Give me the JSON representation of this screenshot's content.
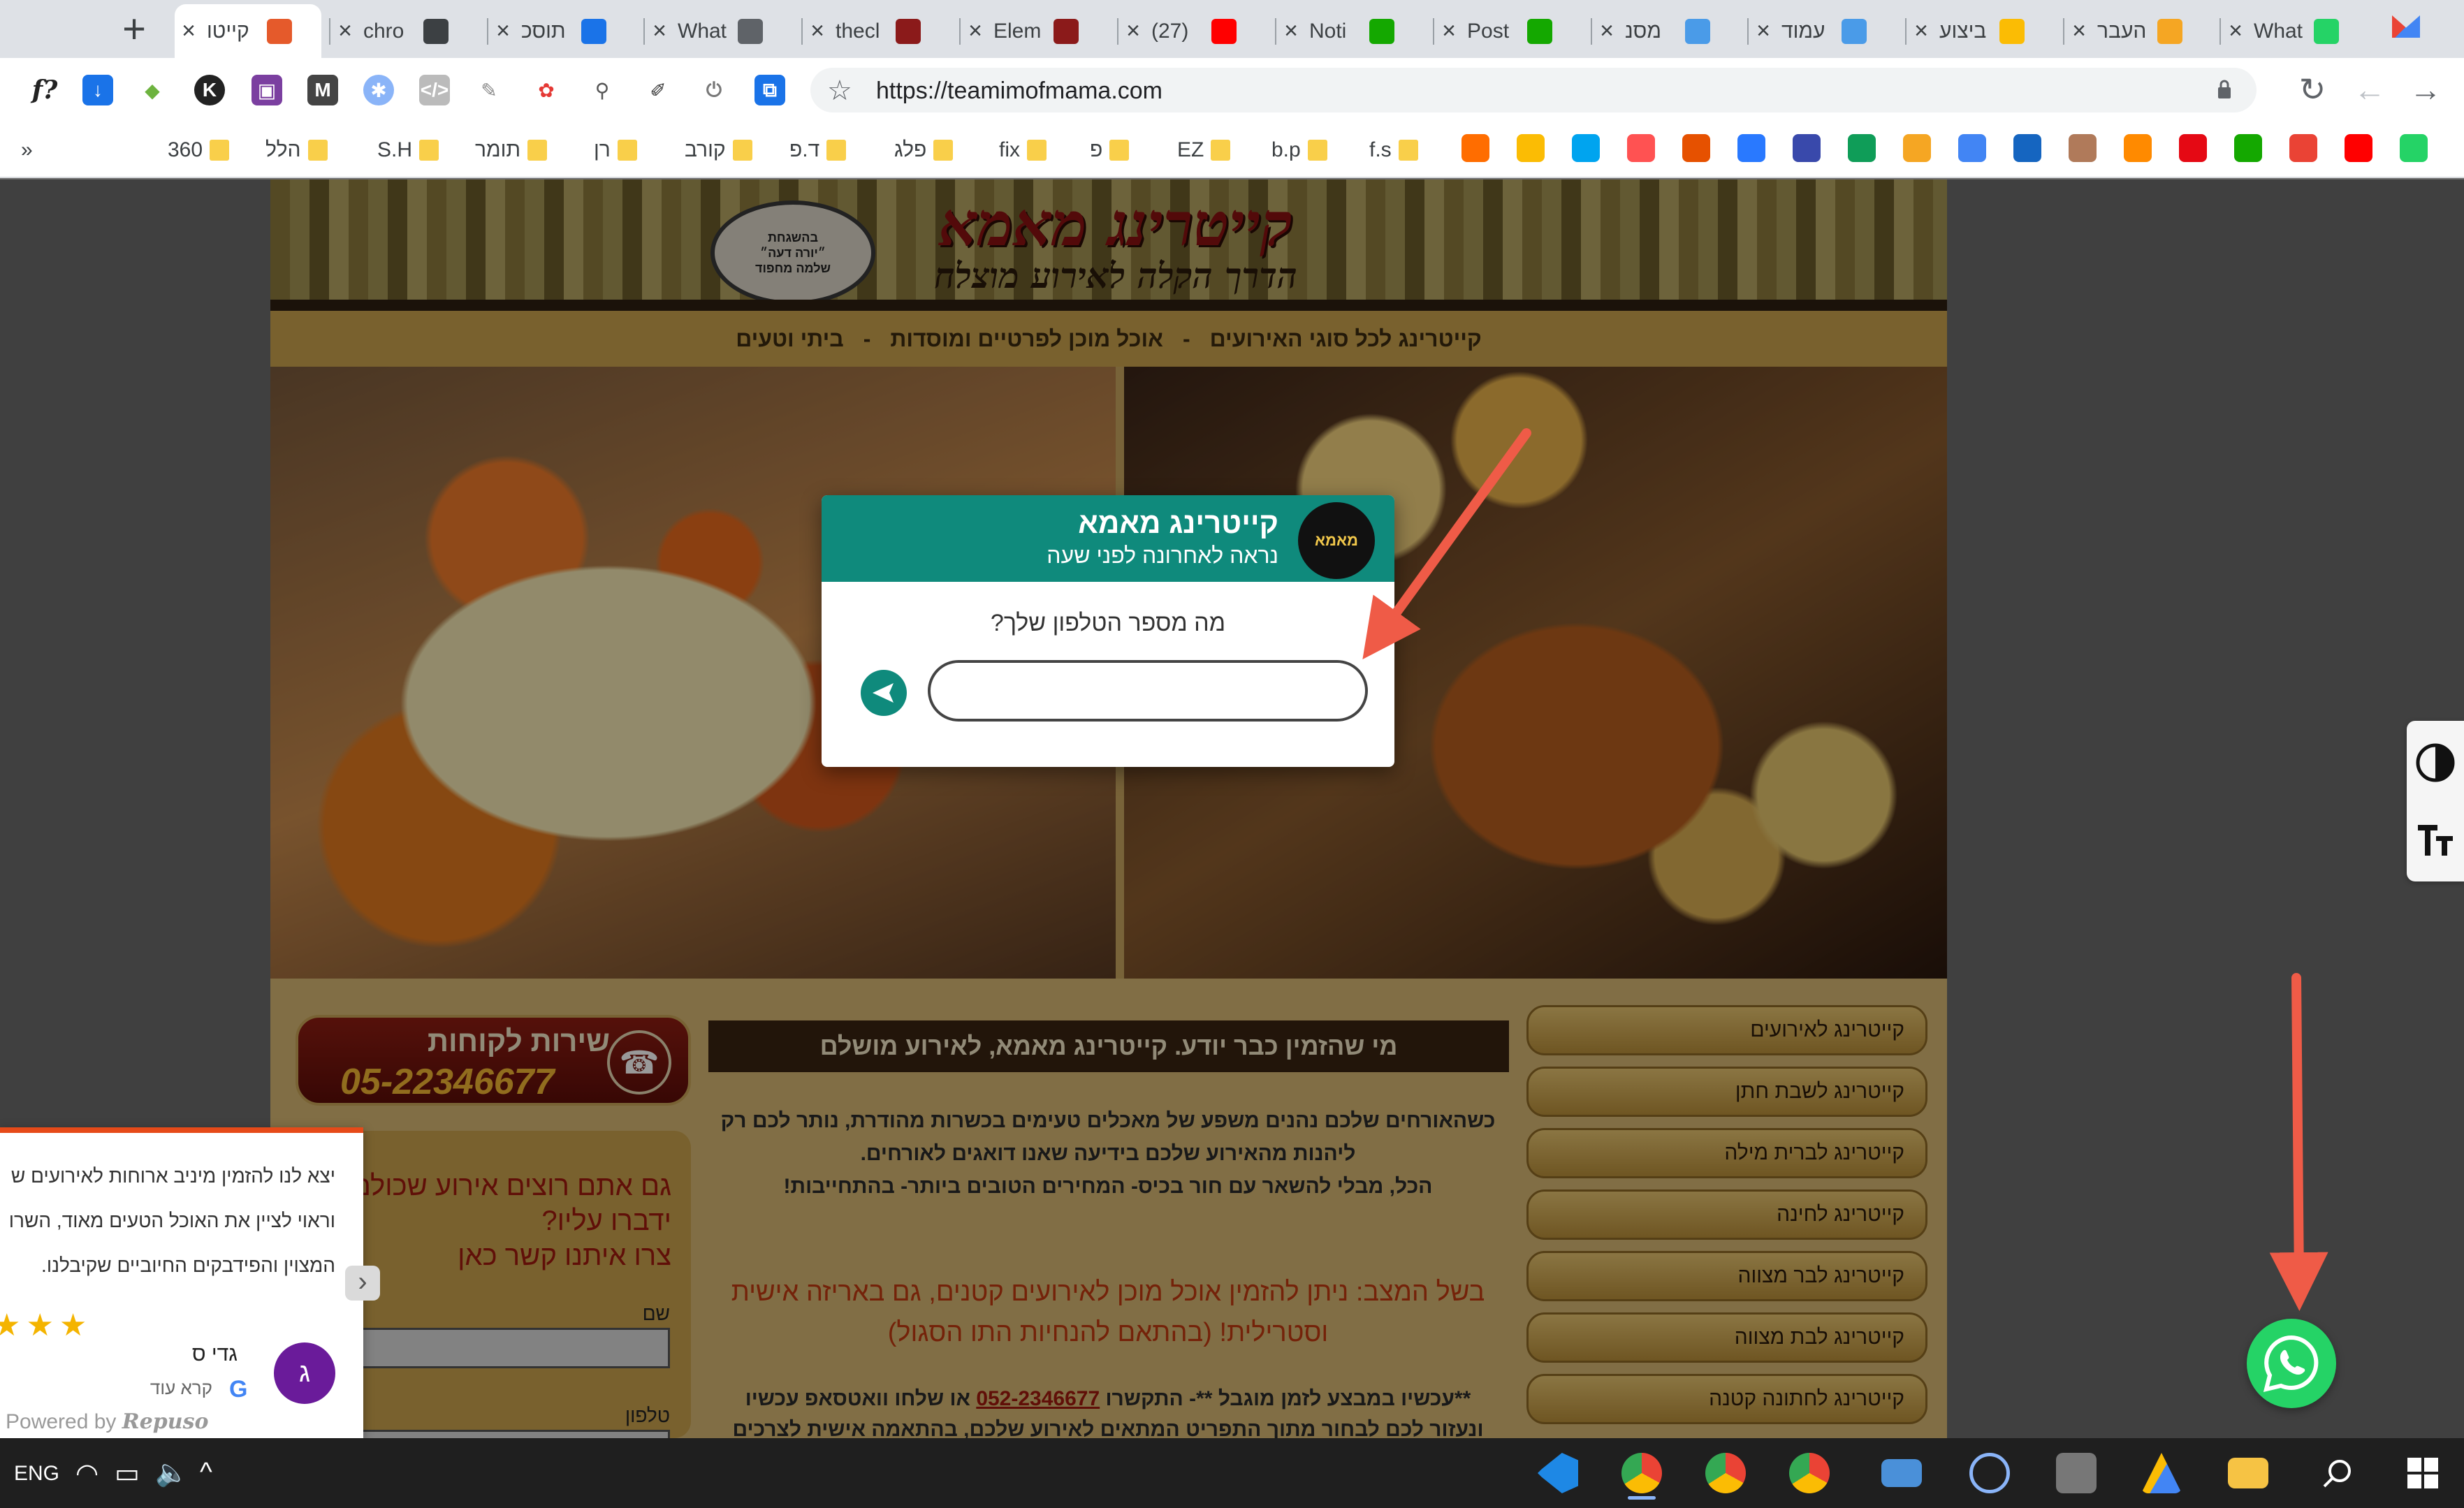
{
  "browser": {
    "tabs": [
      {
        "title": "קייטו",
        "favicon_color": "#e55a2b",
        "active": true
      },
      {
        "title": "chro",
        "favicon_color": "#3c4043",
        "active": false
      },
      {
        "title": "תוסכ",
        "favicon_color": "#1a73e8",
        "active": false
      },
      {
        "title": "What",
        "favicon_color": "#5f6368",
        "active": false
      },
      {
        "title": "thecl",
        "favicon_color": "#8b1a1a",
        "active": false
      },
      {
        "title": "Elem",
        "favicon_color": "#8b1a1a",
        "active": false
      },
      {
        "title": "(27)",
        "favicon_color": "#ff0000",
        "active": false
      },
      {
        "title": "Noti",
        "favicon_color": "#14a800",
        "active": false
      },
      {
        "title": "Post",
        "favicon_color": "#14a800",
        "active": false
      },
      {
        "title": "מסנ",
        "favicon_color": "#4a9be8",
        "active": false
      },
      {
        "title": "עמוד",
        "favicon_color": "#4a9be8",
        "active": false
      },
      {
        "title": "ביצוע",
        "favicon_color": "#fbbc04",
        "active": false
      },
      {
        "title": "העבר",
        "favicon_color": "#f5a623",
        "active": false
      },
      {
        "title": "What",
        "favicon_color": "#25d366",
        "active": false
      }
    ],
    "new_tab_label": "+",
    "url": "https://teamimofmama.com",
    "bookmarks": [
      "360",
      "הלל",
      "S.H",
      "תומר",
      "רן",
      "קורב",
      "ד.פ",
      "פלג",
      "fix",
      "פ",
      "EZ",
      "b.p",
      "f.s"
    ],
    "bookmarks_overflow": "»"
  },
  "site": {
    "name": "קייטרינג מאמא",
    "tagline": "הדרך הקלה לאירוע מוצלח",
    "seal_lines": [
      "בהשגחת",
      "״יורה דעה״",
      "שלמה מחפוד"
    ],
    "nav": [
      "קייטרינג לכל סוגי האירועים",
      "אוכל מוכן לפרטיים ומוסדות",
      "ביתי וטעים"
    ],
    "nav_separator": "-",
    "service_title": "שירות לקוחות",
    "service_phone": "05-22346677",
    "headline": "מי שהזמין כבר יודע. קייטרינג מאמא, לאירוע מושלם",
    "intro_lines": [
      "כשהאורחים שלכם נהנים משפע של מאכלים טעימים בכשרות מהודרת, נותר לכם רק",
      "ליהנות מהאירוע שלכם בידיעה שאנו דואגים לאורחים.",
      "הכל, מבלי להשאר עם חור בכיס- המחירים הטובים ביותר- בהתחייבות!"
    ],
    "status_msg": "בשל המצב: ניתן להזמין אוכל מוכן לאירועים קטנים, גם באריזה אישית וסטרילית! (בהתאם להנחיות התו הסגול)",
    "order_prefix": "**עכשיו במבצע לזמן מוגבל **- התקשרו ",
    "order_phone": "052-2346677",
    "order_suffix": " או שלחו וואטסאפ עכשיו",
    "order_line2": "ונעזור לכם לבחור מתוך התפריט המתאים לאירוע שלכם, בהתאמה אישית לצרכים",
    "form_heading": [
      "גם אתם רוצים אירוע שכולם",
      "ידברו עליו?",
      "צרו איתנו קשר כאן"
    ],
    "form_name_label": "שם",
    "form_phone_label": "טלפון",
    "menu": [
      "קייטרינג לאירועים",
      "קייטרינג לשבת חתן",
      "קייטרינג לברית מילה",
      "קייטרינג לחינה",
      "קייטרינג לבר מצווה",
      "קייטרינג לבת מצווה",
      "קייטרינג לחתונה קטנה"
    ]
  },
  "chat": {
    "name": "קייטרינג מאמא",
    "status": "נראה לאחרונה לפני שעה",
    "avatar_text": "מאמא",
    "question": "מה מספר הטלפון שלך?",
    "input_value": "",
    "accent": "#0f8a7c"
  },
  "review": {
    "lines": [
      "יצא לנו להזמין מיניב ארוחות לאירועים ש",
      "וראוי לציין את האוכל הטעים מאוד, השרו",
      "המצוין והפידבקים החיוביים שקיבלנו."
    ],
    "stars": "★★★",
    "avatar_letter": "ג",
    "reviewer": "גדי ס",
    "read_more": "קרא עוד",
    "google_mark": "G",
    "powered_label": "Powered by",
    "powered_brand": "Repuso"
  },
  "a11y": {
    "contrast_icon": "contrast-icon",
    "font_icon": "text-size-icon"
  },
  "taskbar": {
    "language": "ENG"
  }
}
